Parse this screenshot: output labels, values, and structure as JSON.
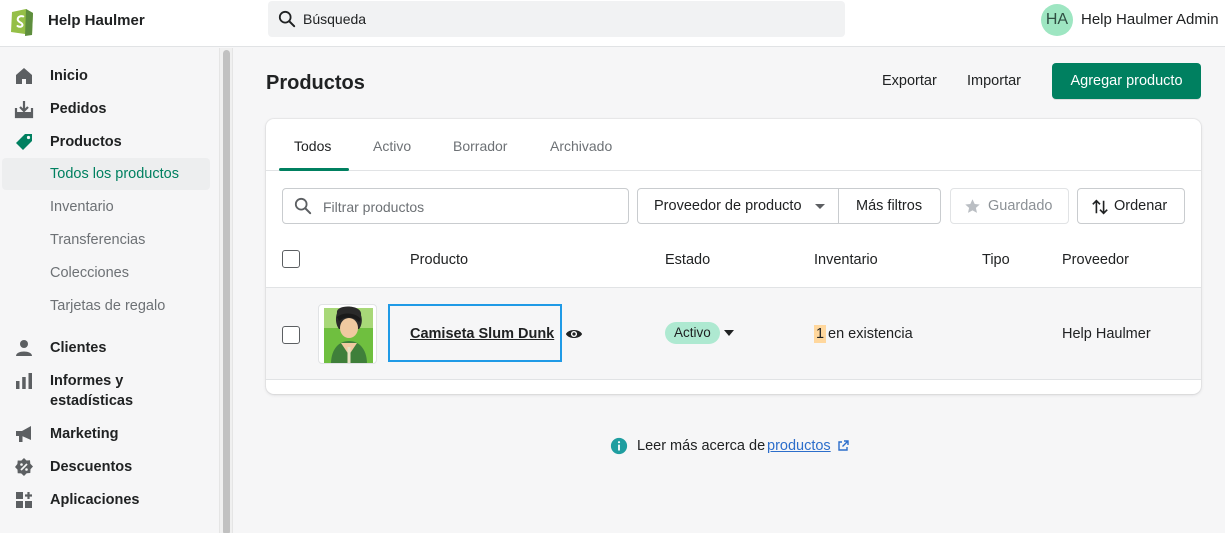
{
  "topbar": {
    "store_name": "Help Haulmer",
    "search_placeholder": "Búsqueda",
    "avatar_initials": "HA",
    "user_name": "Help Haulmer Admin"
  },
  "sidebar": {
    "items": [
      {
        "label": "Inicio",
        "icon": "home-icon"
      },
      {
        "label": "Pedidos",
        "icon": "orders-icon"
      },
      {
        "label": "Productos",
        "icon": "tag-icon"
      },
      {
        "label": "Clientes",
        "icon": "person-icon"
      },
      {
        "label": "Informes y",
        "label2": "estadísticas",
        "icon": "bar-chart-icon"
      },
      {
        "label": "Marketing",
        "icon": "megaphone-icon"
      },
      {
        "label": "Descuentos",
        "icon": "discount-icon"
      },
      {
        "label": "Aplicaciones",
        "icon": "apps-icon"
      }
    ],
    "subitems": [
      {
        "label": "Todos los productos",
        "active": true
      },
      {
        "label": "Inventario"
      },
      {
        "label": "Transferencias"
      },
      {
        "label": "Colecciones"
      },
      {
        "label": "Tarjetas de regalo"
      }
    ]
  },
  "page": {
    "title": "Productos",
    "export_label": "Exportar",
    "import_label": "Importar",
    "add_label": "Agregar producto"
  },
  "tabs": [
    "Todos",
    "Activo",
    "Borrador",
    "Archivado"
  ],
  "filters": {
    "placeholder": "Filtrar productos",
    "vendor_label": "Proveedor de producto",
    "more_label": "Más filtros",
    "saved_label": "Guardado",
    "sort_label": "Ordenar"
  },
  "table": {
    "headers": {
      "product": "Producto",
      "status": "Estado",
      "inventory": "Inventario",
      "type": "Tipo",
      "vendor": "Proveedor"
    },
    "rows": [
      {
        "name": "Camiseta Slum Dunk",
        "status": "Activo",
        "inventory_count": "1",
        "inventory_text": "en existencia",
        "type": "",
        "vendor": "Help Haulmer"
      }
    ]
  },
  "footer": {
    "text": "Leer más acerca de",
    "link": "productos"
  },
  "colors": {
    "primary": "#008060",
    "active_badge": "#aee9d1",
    "link": "#2c6ecb",
    "focus": "#1f9ae6"
  }
}
